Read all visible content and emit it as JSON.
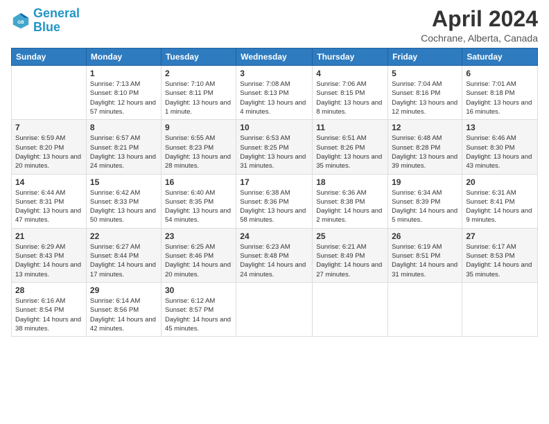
{
  "header": {
    "logo_line1": "General",
    "logo_line2": "Blue",
    "title": "April 2024",
    "subtitle": "Cochrane, Alberta, Canada"
  },
  "days_of_week": [
    "Sunday",
    "Monday",
    "Tuesday",
    "Wednesday",
    "Thursday",
    "Friday",
    "Saturday"
  ],
  "weeks": [
    [
      {
        "day": "",
        "sunrise": "",
        "sunset": "",
        "daylight": ""
      },
      {
        "day": "1",
        "sunrise": "7:13 AM",
        "sunset": "8:10 PM",
        "daylight": "12 hours and 57 minutes."
      },
      {
        "day": "2",
        "sunrise": "7:10 AM",
        "sunset": "8:11 PM",
        "daylight": "13 hours and 1 minute."
      },
      {
        "day": "3",
        "sunrise": "7:08 AM",
        "sunset": "8:13 PM",
        "daylight": "13 hours and 4 minutes."
      },
      {
        "day": "4",
        "sunrise": "7:06 AM",
        "sunset": "8:15 PM",
        "daylight": "13 hours and 8 minutes."
      },
      {
        "day": "5",
        "sunrise": "7:04 AM",
        "sunset": "8:16 PM",
        "daylight": "13 hours and 12 minutes."
      },
      {
        "day": "6",
        "sunrise": "7:01 AM",
        "sunset": "8:18 PM",
        "daylight": "13 hours and 16 minutes."
      }
    ],
    [
      {
        "day": "7",
        "sunrise": "6:59 AM",
        "sunset": "8:20 PM",
        "daylight": "13 hours and 20 minutes."
      },
      {
        "day": "8",
        "sunrise": "6:57 AM",
        "sunset": "8:21 PM",
        "daylight": "13 hours and 24 minutes."
      },
      {
        "day": "9",
        "sunrise": "6:55 AM",
        "sunset": "8:23 PM",
        "daylight": "13 hours and 28 minutes."
      },
      {
        "day": "10",
        "sunrise": "6:53 AM",
        "sunset": "8:25 PM",
        "daylight": "13 hours and 31 minutes."
      },
      {
        "day": "11",
        "sunrise": "6:51 AM",
        "sunset": "8:26 PM",
        "daylight": "13 hours and 35 minutes."
      },
      {
        "day": "12",
        "sunrise": "6:48 AM",
        "sunset": "8:28 PM",
        "daylight": "13 hours and 39 minutes."
      },
      {
        "day": "13",
        "sunrise": "6:46 AM",
        "sunset": "8:30 PM",
        "daylight": "13 hours and 43 minutes."
      }
    ],
    [
      {
        "day": "14",
        "sunrise": "6:44 AM",
        "sunset": "8:31 PM",
        "daylight": "13 hours and 47 minutes."
      },
      {
        "day": "15",
        "sunrise": "6:42 AM",
        "sunset": "8:33 PM",
        "daylight": "13 hours and 50 minutes."
      },
      {
        "day": "16",
        "sunrise": "6:40 AM",
        "sunset": "8:35 PM",
        "daylight": "13 hours and 54 minutes."
      },
      {
        "day": "17",
        "sunrise": "6:38 AM",
        "sunset": "8:36 PM",
        "daylight": "13 hours and 58 minutes."
      },
      {
        "day": "18",
        "sunrise": "6:36 AM",
        "sunset": "8:38 PM",
        "daylight": "14 hours and 2 minutes."
      },
      {
        "day": "19",
        "sunrise": "6:34 AM",
        "sunset": "8:39 PM",
        "daylight": "14 hours and 5 minutes."
      },
      {
        "day": "20",
        "sunrise": "6:31 AM",
        "sunset": "8:41 PM",
        "daylight": "14 hours and 9 minutes."
      }
    ],
    [
      {
        "day": "21",
        "sunrise": "6:29 AM",
        "sunset": "8:43 PM",
        "daylight": "14 hours and 13 minutes."
      },
      {
        "day": "22",
        "sunrise": "6:27 AM",
        "sunset": "8:44 PM",
        "daylight": "14 hours and 17 minutes."
      },
      {
        "day": "23",
        "sunrise": "6:25 AM",
        "sunset": "8:46 PM",
        "daylight": "14 hours and 20 minutes."
      },
      {
        "day": "24",
        "sunrise": "6:23 AM",
        "sunset": "8:48 PM",
        "daylight": "14 hours and 24 minutes."
      },
      {
        "day": "25",
        "sunrise": "6:21 AM",
        "sunset": "8:49 PM",
        "daylight": "14 hours and 27 minutes."
      },
      {
        "day": "26",
        "sunrise": "6:19 AM",
        "sunset": "8:51 PM",
        "daylight": "14 hours and 31 minutes."
      },
      {
        "day": "27",
        "sunrise": "6:17 AM",
        "sunset": "8:53 PM",
        "daylight": "14 hours and 35 minutes."
      }
    ],
    [
      {
        "day": "28",
        "sunrise": "6:16 AM",
        "sunset": "8:54 PM",
        "daylight": "14 hours and 38 minutes."
      },
      {
        "day": "29",
        "sunrise": "6:14 AM",
        "sunset": "8:56 PM",
        "daylight": "14 hours and 42 minutes."
      },
      {
        "day": "30",
        "sunrise": "6:12 AM",
        "sunset": "8:57 PM",
        "daylight": "14 hours and 45 minutes."
      },
      {
        "day": "",
        "sunrise": "",
        "sunset": "",
        "daylight": ""
      },
      {
        "day": "",
        "sunrise": "",
        "sunset": "",
        "daylight": ""
      },
      {
        "day": "",
        "sunrise": "",
        "sunset": "",
        "daylight": ""
      },
      {
        "day": "",
        "sunrise": "",
        "sunset": "",
        "daylight": ""
      }
    ]
  ]
}
